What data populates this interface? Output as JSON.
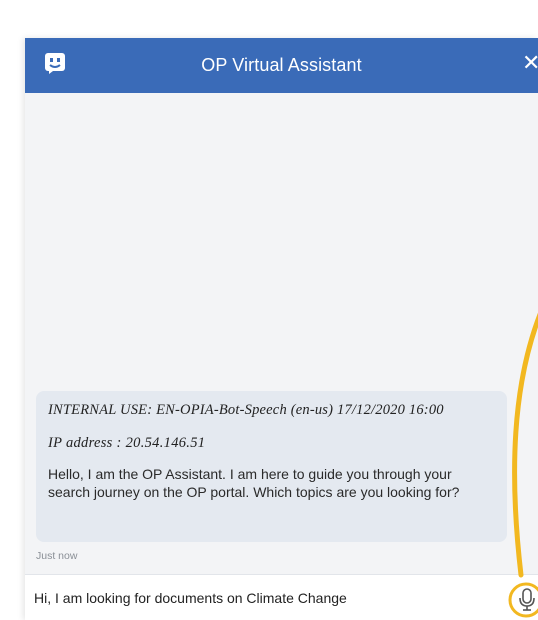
{
  "header": {
    "title": "OP Virtual Assistant",
    "close_label": "✕"
  },
  "messages": [
    {
      "internal_line": "INTERNAL USE: EN-OPIA-Bot-Speech (en-us) 17/12/2020 16:00",
      "ip_line": "IP address : 20.54.146.51",
      "text": "Hello, I am the OP Assistant. I am here to guide you through your search journey on the OP portal. Which topics are you looking for?",
      "timestamp": "Just now"
    }
  ],
  "composer": {
    "value": "Hi, I am looking for documents on Climate Change"
  },
  "icons": {
    "bot": "bot-face-icon",
    "close": "close-icon",
    "mic": "microphone-icon"
  },
  "colors": {
    "header": "#3a6bb8",
    "bubble": "#e4e9f0",
    "highlight": "#f2b820"
  }
}
